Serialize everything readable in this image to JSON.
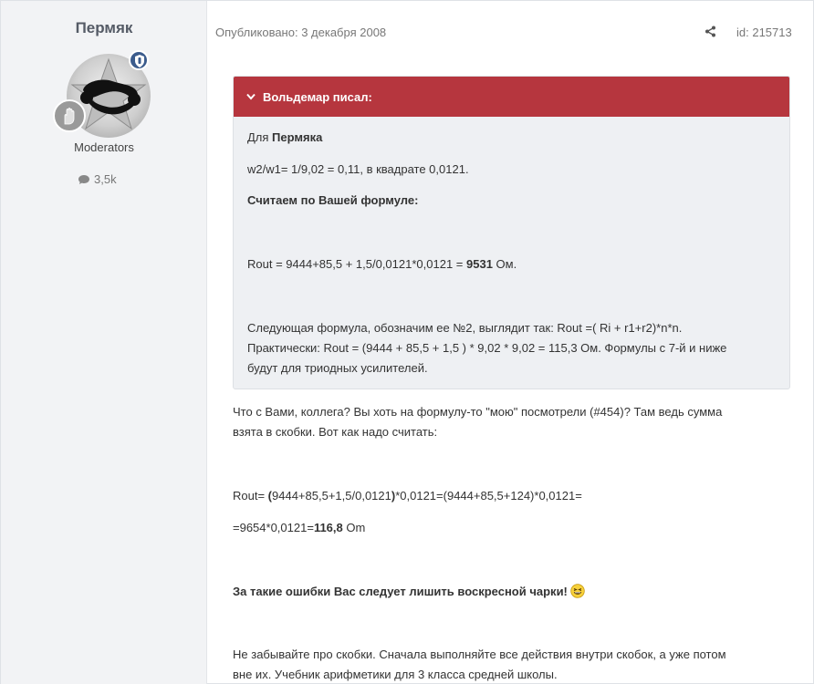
{
  "author": {
    "name": "Пермяк",
    "group": "Moderators",
    "posts_count": "3,5k"
  },
  "meta": {
    "published": "Опубликовано: 3 декабря 2008",
    "post_id": "id: 215713"
  },
  "quote": {
    "header": "Вольдемар писал:",
    "line1_prefix": "Для ",
    "line1_bold": "Пермяка",
    "line2": "w2/w1= 1/9,02 = 0,11, в квадрате 0,0121.",
    "line3_bold": "Считаем по Вашей формуле:",
    "line4_prefix": "Rout = 9444+85,5 + 1,5/0,0121*0,0121 = ",
    "line4_bold": "9531",
    "line4_suffix": " Ом.",
    "line5": "Следующая формула, обозначим ее №2, выглядит так: Rout =( Ri + r1+r2)*n*n.",
    "line6": "Практически: Rout = (9444 + 85,5 + 1,5 ) * 9,02 * 9,02 = 115,3 Ом. Формулы с 7-й и ниже",
    "line7": "будут для триодных усилителей."
  },
  "content": {
    "p1_line1": "Что с Вами, коллега? Вы хоть на формулу-то \"мою\" посмотрели (#454)? Там ведь сумма",
    "p1_line2": "взята в скобки. Вот как надо считать:",
    "calc1_prefix": "Rout= ",
    "calc1_bold1": "(",
    "calc1_mid": "9444+85,5+1,5/0,0121",
    "calc1_bold2": ")",
    "calc1_suffix": "*0,0121=(9444+85,5+124)*0,0121=",
    "calc2_prefix": "=9654*0,0121=",
    "calc2_bold": "116,8",
    "calc2_suffix": " Om",
    "bold_line": "За такие ошибки Вас следует лишить воскресной чарки!",
    "last_line1": "Не забывайте про скобки. Сначала выполняйте все действия внутри скобок, а уже потом",
    "last_line2": "вне их. Учебник арифметики для 3 класса средней школы."
  },
  "colors": {
    "quote_header": "#b6363e",
    "author_name": "#555b66",
    "mod_badge": "#3b5b8c"
  },
  "icons": {
    "share": "share-icon",
    "comment": "comment-icon",
    "chevron": "chevron-down-icon",
    "emoji": "laughing-emoji-icon"
  }
}
